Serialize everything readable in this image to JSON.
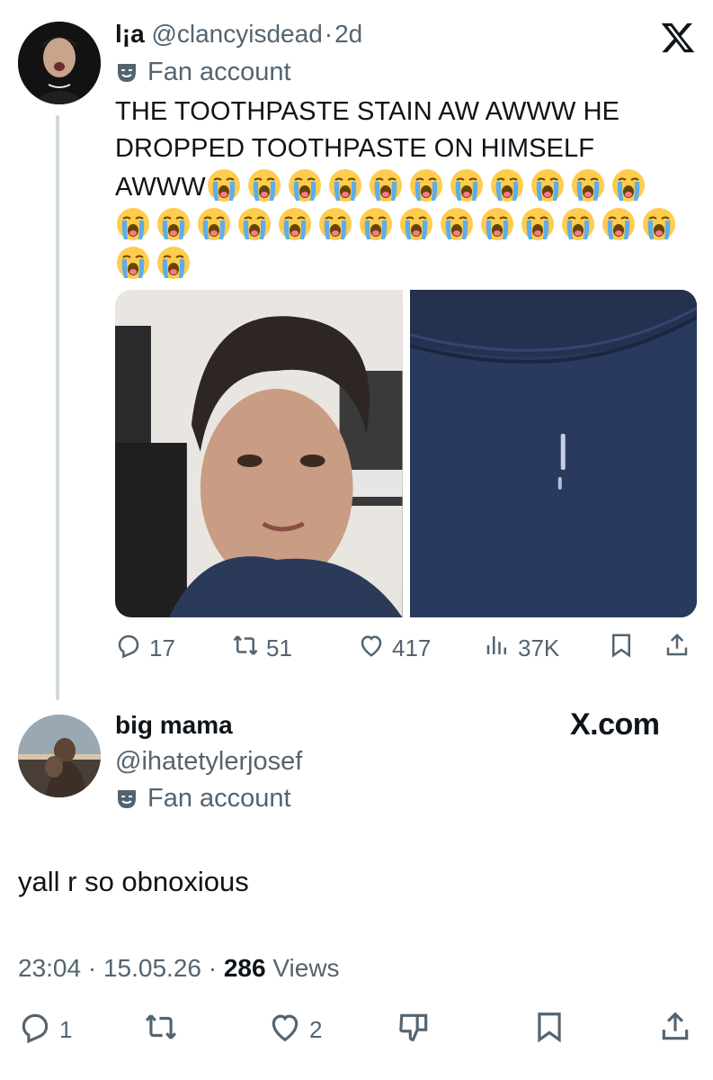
{
  "tweet1": {
    "display_name": "l¡a",
    "handle": "@clancyisdead",
    "time_ago": "2d",
    "fan_label": "Fan account",
    "text": "THE TOOTHPASTE STAIN AW AWWW HE DROPPED TOOTHPASTE ON HIMSELF AWWW",
    "emoji_name": "loudly-crying-face",
    "emoji_count": 27,
    "actions": {
      "replies": "17",
      "reposts": "51",
      "likes": "417",
      "views": "37K"
    }
  },
  "tweet2": {
    "display_name": "big mama",
    "handle": "@ihatetylerjosef",
    "fan_label": "Fan account",
    "text": "yall r so obnoxious",
    "time": "23:04",
    "date": "15.05.26",
    "views_count": "286",
    "views_label": "Views",
    "actions": {
      "replies": "1",
      "likes": "2"
    }
  },
  "watermark": "X.com",
  "colors": {
    "text": "#0f1419",
    "muted": "#536471",
    "thread_line": "#cfd9de",
    "emoji_yellow": "#ffcc4d",
    "emoji_tears": "#5dadec"
  }
}
